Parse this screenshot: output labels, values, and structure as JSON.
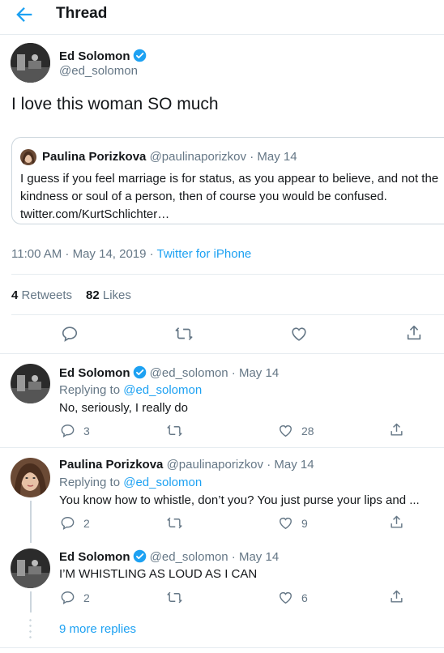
{
  "header": {
    "title": "Thread"
  },
  "main_tweet": {
    "author": {
      "name": "Ed Solomon",
      "handle": "@ed_solomon"
    },
    "text": "I love this woman SO much",
    "quote": {
      "author": {
        "name": "Paulina Porizkova",
        "handle": "@paulinaporizkov",
        "date": "May 14"
      },
      "text": "I guess if you feel marriage is for status, as you appear to believe, and not the kindness or soul of a person, then of course you would be confused.",
      "link": "twitter.com/KurtSchlichter…"
    },
    "timestamp": "11:00 AM · May 14, 2019 · ",
    "source": "Twitter for iPhone",
    "stats": {
      "retweets_count": "4",
      "retweets_label": "Retweets",
      "likes_count": "82",
      "likes_label": "Likes"
    }
  },
  "replies": [
    {
      "name": "Ed Solomon",
      "handle": "@ed_solomon",
      "date": "May 14",
      "replying_prefix": "Replying to ",
      "replying_to": "@ed_solomon",
      "text": "No, seriously, I really do",
      "reply_count": "3",
      "retweet_count": "",
      "like_count": "28"
    },
    {
      "name": "Paulina Porizkova",
      "handle": "@paulinaporizkov",
      "date": "May 14",
      "replying_prefix": "Replying to ",
      "replying_to": "@ed_solomon",
      "text": "You know how to whistle, don’t you? You just purse your lips and ...",
      "reply_count": "2",
      "retweet_count": "",
      "like_count": "9"
    },
    {
      "name": "Ed Solomon",
      "handle": "@ed_solomon",
      "date": "May 14",
      "text": "I’M WHISTLING AS LOUD AS I CAN",
      "reply_count": "2",
      "retweet_count": "",
      "like_count": "6"
    }
  ],
  "more_replies": "9 more replies",
  "sep": " · ",
  "colors": {
    "accent": "#1da1f2",
    "text": "#14171a",
    "muted": "#657786",
    "border": "#e6ecf0"
  },
  "icons": [
    "back-arrow-icon",
    "verified-badge-icon",
    "reply-icon",
    "retweet-icon",
    "like-icon",
    "share-icon"
  ]
}
